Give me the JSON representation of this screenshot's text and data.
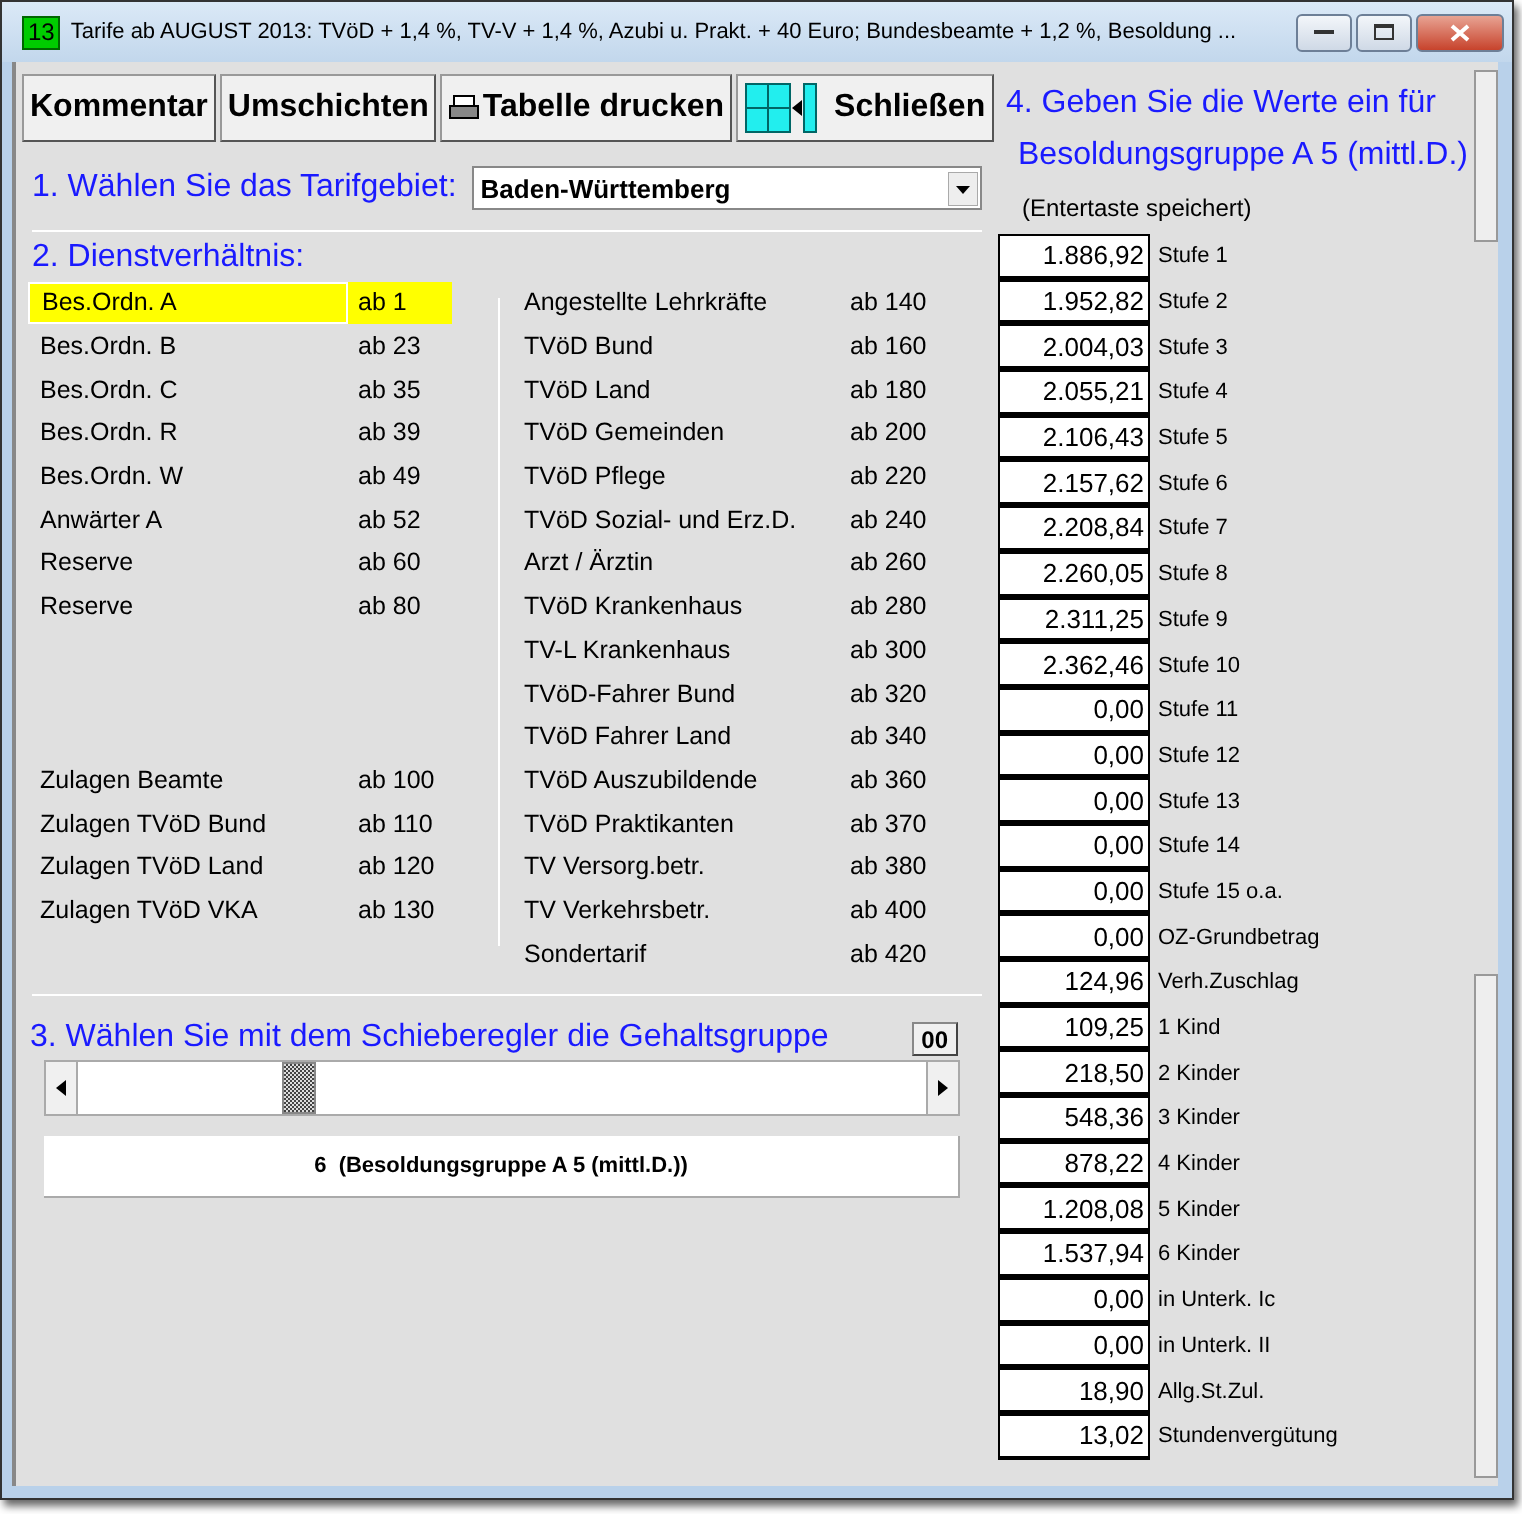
{
  "window": {
    "badge": "13",
    "title": "Tarife ab AUGUST 2013:  TVöD + 1,4 %, TV-V + 1,4 %, Azubi u. Prakt. + 40 Euro; Bundesbeamte + 1,2 %, Besoldung ..."
  },
  "toolbar": [
    {
      "label": "Kommentar",
      "kind": "text"
    },
    {
      "label": "Umschichten",
      "kind": "text"
    },
    {
      "label": "Tabelle drucken",
      "kind": "print"
    },
    {
      "label": "Schließen",
      "kind": "close"
    }
  ],
  "step1": {
    "label": "1. Wählen Sie das Tarifgebiet:",
    "value": "Baden-Württemberg"
  },
  "step2": {
    "label": "2. Dienstverhältnis:",
    "left_groups": [
      [
        {
          "name": "Bes.Ordn. A",
          "code": "ab 1",
          "selected": true
        },
        {
          "name": "Bes.Ordn. B",
          "code": "ab 23",
          "selected": false
        },
        {
          "name": "Bes.Ordn. C",
          "code": "ab 35",
          "selected": false
        },
        {
          "name": "Bes.Ordn. R",
          "code": "ab 39",
          "selected": false
        },
        {
          "name": "Bes.Ordn. W",
          "code": "ab 49",
          "selected": false
        },
        {
          "name": "Anwärter A",
          "code": "ab 52",
          "selected": false
        },
        {
          "name": "Reserve",
          "code": "ab 60",
          "selected": false
        },
        {
          "name": "Reserve",
          "code": "ab 80",
          "selected": false
        }
      ],
      [
        {
          "name": "Zulagen Beamte",
          "code": "ab 100",
          "selected": false
        },
        {
          "name": "Zulagen TVöD Bund",
          "code": "ab 110",
          "selected": false
        },
        {
          "name": "Zulagen TVöD Land",
          "code": "ab 120",
          "selected": false
        },
        {
          "name": "Zulagen TVöD VKA",
          "code": "ab 130",
          "selected": false
        }
      ]
    ],
    "right": [
      {
        "name": "Angestellte Lehrkräfte",
        "code": "ab 140",
        "selected": false
      },
      {
        "name": "TVöD Bund",
        "code": "ab 160",
        "selected": false
      },
      {
        "name": "TVöD Land",
        "code": "ab 180",
        "selected": false
      },
      {
        "name": "TVöD Gemeinden",
        "code": "ab 200",
        "selected": false
      },
      {
        "name": "TVöD Pflege",
        "code": "ab 220",
        "selected": false
      },
      {
        "name": "TVöD Sozial- und Erz.D.",
        "code": "ab 240",
        "selected": false
      },
      {
        "name": "Arzt / Ärztin",
        "code": "ab 260",
        "selected": false
      },
      {
        "name": "TVöD Krankenhaus",
        "code": "ab 280",
        "selected": false
      },
      {
        "name": "TV-L Krankenhaus",
        "code": "ab 300",
        "selected": false
      },
      {
        "name": "TVöD-Fahrer Bund",
        "code": "ab 320",
        "selected": false
      },
      {
        "name": "TVöD Fahrer Land",
        "code": "ab 340",
        "selected": false
      },
      {
        "name": "TVöD Auszubildende",
        "code": "ab 360",
        "selected": false
      },
      {
        "name": "TVöD Praktikanten",
        "code": "ab 370",
        "selected": false
      },
      {
        "name": "TV Versorg.betr.",
        "code": "ab 380",
        "selected": false
      },
      {
        "name": "TV Verkehrsbetr.",
        "code": "ab 400",
        "selected": false
      },
      {
        "name": "Sondertarif",
        "code": "ab 420",
        "selected": false
      }
    ]
  },
  "step3": {
    "label": "3. Wählen Sie mit dem Schieberegler die Gehaltsgruppe",
    "button": "00",
    "level": 0.25,
    "result": "6  (Besoldungsgruppe A 5 (mittl.D.))"
  },
  "step4": {
    "label": "4. Geben Sie die Werte ein für",
    "group": "Besoldungsgruppe A 5 (mittl.D.)",
    "hint": "(Entertaste speichert)",
    "values": [
      {
        "value": "1.886,92",
        "label": "Stufe 1"
      },
      {
        "value": "1.952,82",
        "label": "Stufe 2"
      },
      {
        "value": "2.004,03",
        "label": "Stufe 3"
      },
      {
        "value": "2.055,21",
        "label": "Stufe 4"
      },
      {
        "value": "2.106,43",
        "label": "Stufe 5"
      },
      {
        "value": "2.157,62",
        "label": "Stufe 6"
      },
      {
        "value": "2.208,84",
        "label": "Stufe 7"
      },
      {
        "value": "2.260,05",
        "label": "Stufe 8"
      },
      {
        "value": "2.311,25",
        "label": "Stufe 9"
      },
      {
        "value": "2.362,46",
        "label": "Stufe 10"
      },
      {
        "value": "0,00",
        "label": "Stufe 11"
      },
      {
        "value": "0,00",
        "label": "Stufe 12"
      },
      {
        "value": "0,00",
        "label": "Stufe 13"
      },
      {
        "value": "0,00",
        "label": "Stufe 14"
      },
      {
        "value": "0,00",
        "label": "Stufe 15 o.a."
      },
      {
        "value": "0,00",
        "label": "OZ-Grundbetrag"
      },
      {
        "value": "124,96",
        "label": "Verh.Zuschlag"
      },
      {
        "value": "109,25",
        "label": "1 Kind"
      },
      {
        "value": "218,50",
        "label": "2 Kinder"
      },
      {
        "value": "548,36",
        "label": "3 Kinder"
      },
      {
        "value": "878,22",
        "label": "4 Kinder"
      },
      {
        "value": "1.208,08",
        "label": "5 Kinder"
      },
      {
        "value": "1.537,94",
        "label": "6 Kinder"
      },
      {
        "value": "0,00",
        "label": "in Unterk. Ic"
      },
      {
        "value": "0,00",
        "label": "in Unterk. II"
      },
      {
        "value": "18,90",
        "label": "Allg.St.Zul."
      },
      {
        "value": "13,02",
        "label": "Stundenvergütung"
      }
    ]
  }
}
